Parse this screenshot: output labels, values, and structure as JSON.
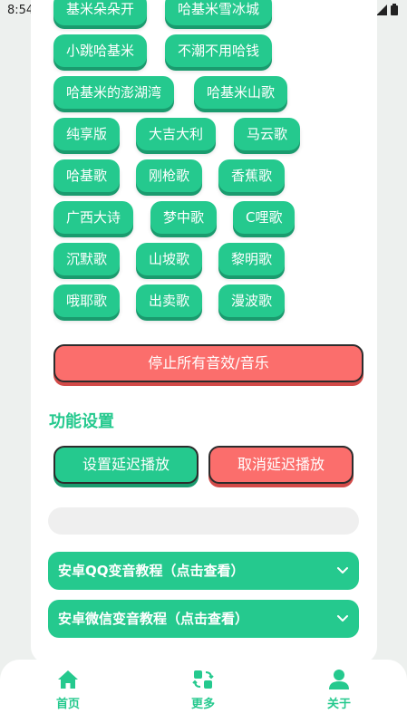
{
  "status_bar": {
    "time": "8:54"
  },
  "sound_buttons": [
    "基米朵朵开",
    "哈基米雪冰城",
    "小跳哈基米",
    "不潮不用哈钱",
    "哈基米的澎湖湾",
    "哈基米山歌",
    "纯享版",
    "大吉大利",
    "马云歌",
    "哈基歌",
    "刚枪歌",
    "香蕉歌",
    "广西大诗",
    "梦中歌",
    "C哩歌",
    "沉默歌",
    "山坡歌",
    "黎明歌",
    "哦耶歌",
    "出卖歌",
    "漫波歌"
  ],
  "stop_all_label": "停止所有音效/音乐",
  "settings": {
    "title": "功能设置",
    "set_delay_label": "设置延迟播放",
    "cancel_delay_label": "取消延迟播放",
    "progress": 0
  },
  "tutorials": [
    "安卓QQ变音教程（点击查看）",
    "安卓微信变音教程（点击查看）"
  ],
  "bottom_nav": [
    {
      "label": "首页",
      "icon": "home-icon"
    },
    {
      "label": "更多",
      "icon": "swap-icon"
    },
    {
      "label": "关于",
      "icon": "user-icon"
    }
  ],
  "colors": {
    "accent": "#25c98e",
    "danger": "#fb6e6c"
  }
}
